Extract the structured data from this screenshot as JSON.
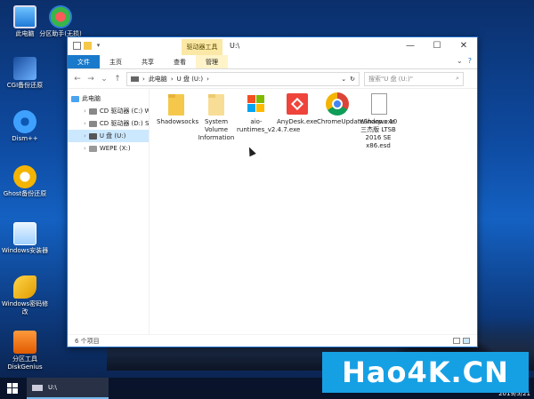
{
  "desktop": {
    "icons": [
      {
        "label": "此电脑"
      },
      {
        "label": "分区助手(无损)"
      },
      {
        "label": "CGI备份还原"
      },
      {
        "label": "Dism++"
      },
      {
        "label": "Ghost备份还原"
      },
      {
        "label": "Windows安装器"
      },
      {
        "label": "Windows密码修改"
      },
      {
        "label": "分区工具DiskGenius"
      }
    ]
  },
  "window": {
    "contextual_tab": "驱动器工具",
    "title": "U:\\",
    "controls": {
      "minimize": "—",
      "maximize": "☐",
      "close": "✕"
    },
    "ribbon_tabs": [
      "文件",
      "主页",
      "共享",
      "查看",
      "管理"
    ],
    "ribbon_right": {
      "expand": "⌄",
      "help": "?"
    },
    "address": {
      "path": [
        "此电脑",
        "U 盘 (U:)"
      ],
      "dropdown": "⌄",
      "refresh": "↻"
    },
    "search_placeholder": "搜索\"U 盘 (U:)\"",
    "nav_pane": [
      {
        "label": "此电脑"
      },
      {
        "label": "CD 驱动器 (C:) Wi"
      },
      {
        "label": "CD 驱动器 (D:) SYN"
      },
      {
        "label": "U 盘 (U:)"
      },
      {
        "label": "WEPE (X:)"
      }
    ],
    "files": [
      {
        "name": "Shadowsocks",
        "icon": "folder-icon"
      },
      {
        "name": "System Volume Information",
        "icon": "folder-icon"
      },
      {
        "name": "aio-runtimes_v2.4.7.exe",
        "icon": "windows-installer-icon"
      },
      {
        "name": "AnyDesk.exe",
        "icon": "anydesk-icon"
      },
      {
        "name": "ChromeUpdateSharp.exe",
        "icon": "chrome-icon"
      },
      {
        "name": "Windows 10 三杰版 LTSB 2016 SE x86.esd",
        "icon": "document-icon"
      }
    ],
    "status": "6 个项目"
  },
  "taskbar": {
    "task_label": "U:\\",
    "clock": "2019/5/21"
  },
  "watermark": "Hao4K.CN",
  "colors": {
    "accent": "#1979ca",
    "selection": "#cce8ff",
    "folder": "#f5c84c",
    "watermark": "#16a0e4"
  }
}
